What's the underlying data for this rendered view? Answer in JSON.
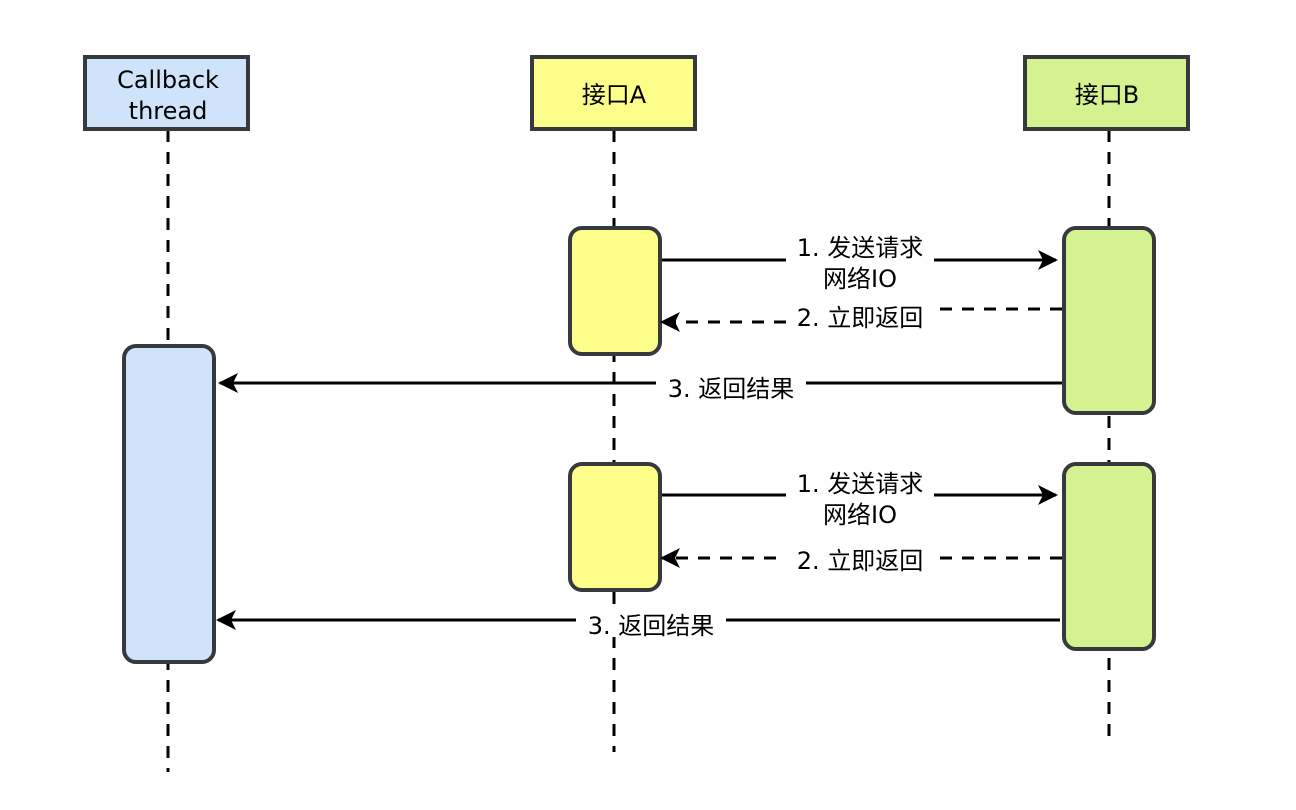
{
  "colors": {
    "callback_fill": "#cfe3fb",
    "a_fill": "#fdfd8a",
    "b_fill": "#d5f291",
    "stroke": "#36393d",
    "line": "#000000"
  },
  "participants": [
    {
      "id": "callback",
      "label_lines": [
        "Callback",
        "thread"
      ]
    },
    {
      "id": "a",
      "label_lines": [
        "接口A"
      ]
    },
    {
      "id": "b",
      "label_lines": [
        "接口B"
      ]
    }
  ],
  "messages": [
    {
      "step": 1,
      "group": 1,
      "lines": [
        "1. 发送请求",
        "网络IO"
      ],
      "from": "a",
      "to": "b",
      "style": "solid"
    },
    {
      "step": 2,
      "group": 1,
      "lines": [
        "2. 立即返回"
      ],
      "from": "b",
      "to": "a",
      "style": "dashed"
    },
    {
      "step": 3,
      "group": 1,
      "lines": [
        "3. 返回结果"
      ],
      "from": "b",
      "to": "callback",
      "style": "solid"
    },
    {
      "step": 1,
      "group": 2,
      "lines": [
        "1. 发送请求",
        "网络IO"
      ],
      "from": "a",
      "to": "b",
      "style": "solid"
    },
    {
      "step": 2,
      "group": 2,
      "lines": [
        "2. 立即返回"
      ],
      "from": "b",
      "to": "a",
      "style": "dashed"
    },
    {
      "step": 3,
      "group": 2,
      "lines": [
        "3. 返回结果"
      ],
      "from": "b",
      "to": "callback",
      "style": "solid"
    }
  ]
}
